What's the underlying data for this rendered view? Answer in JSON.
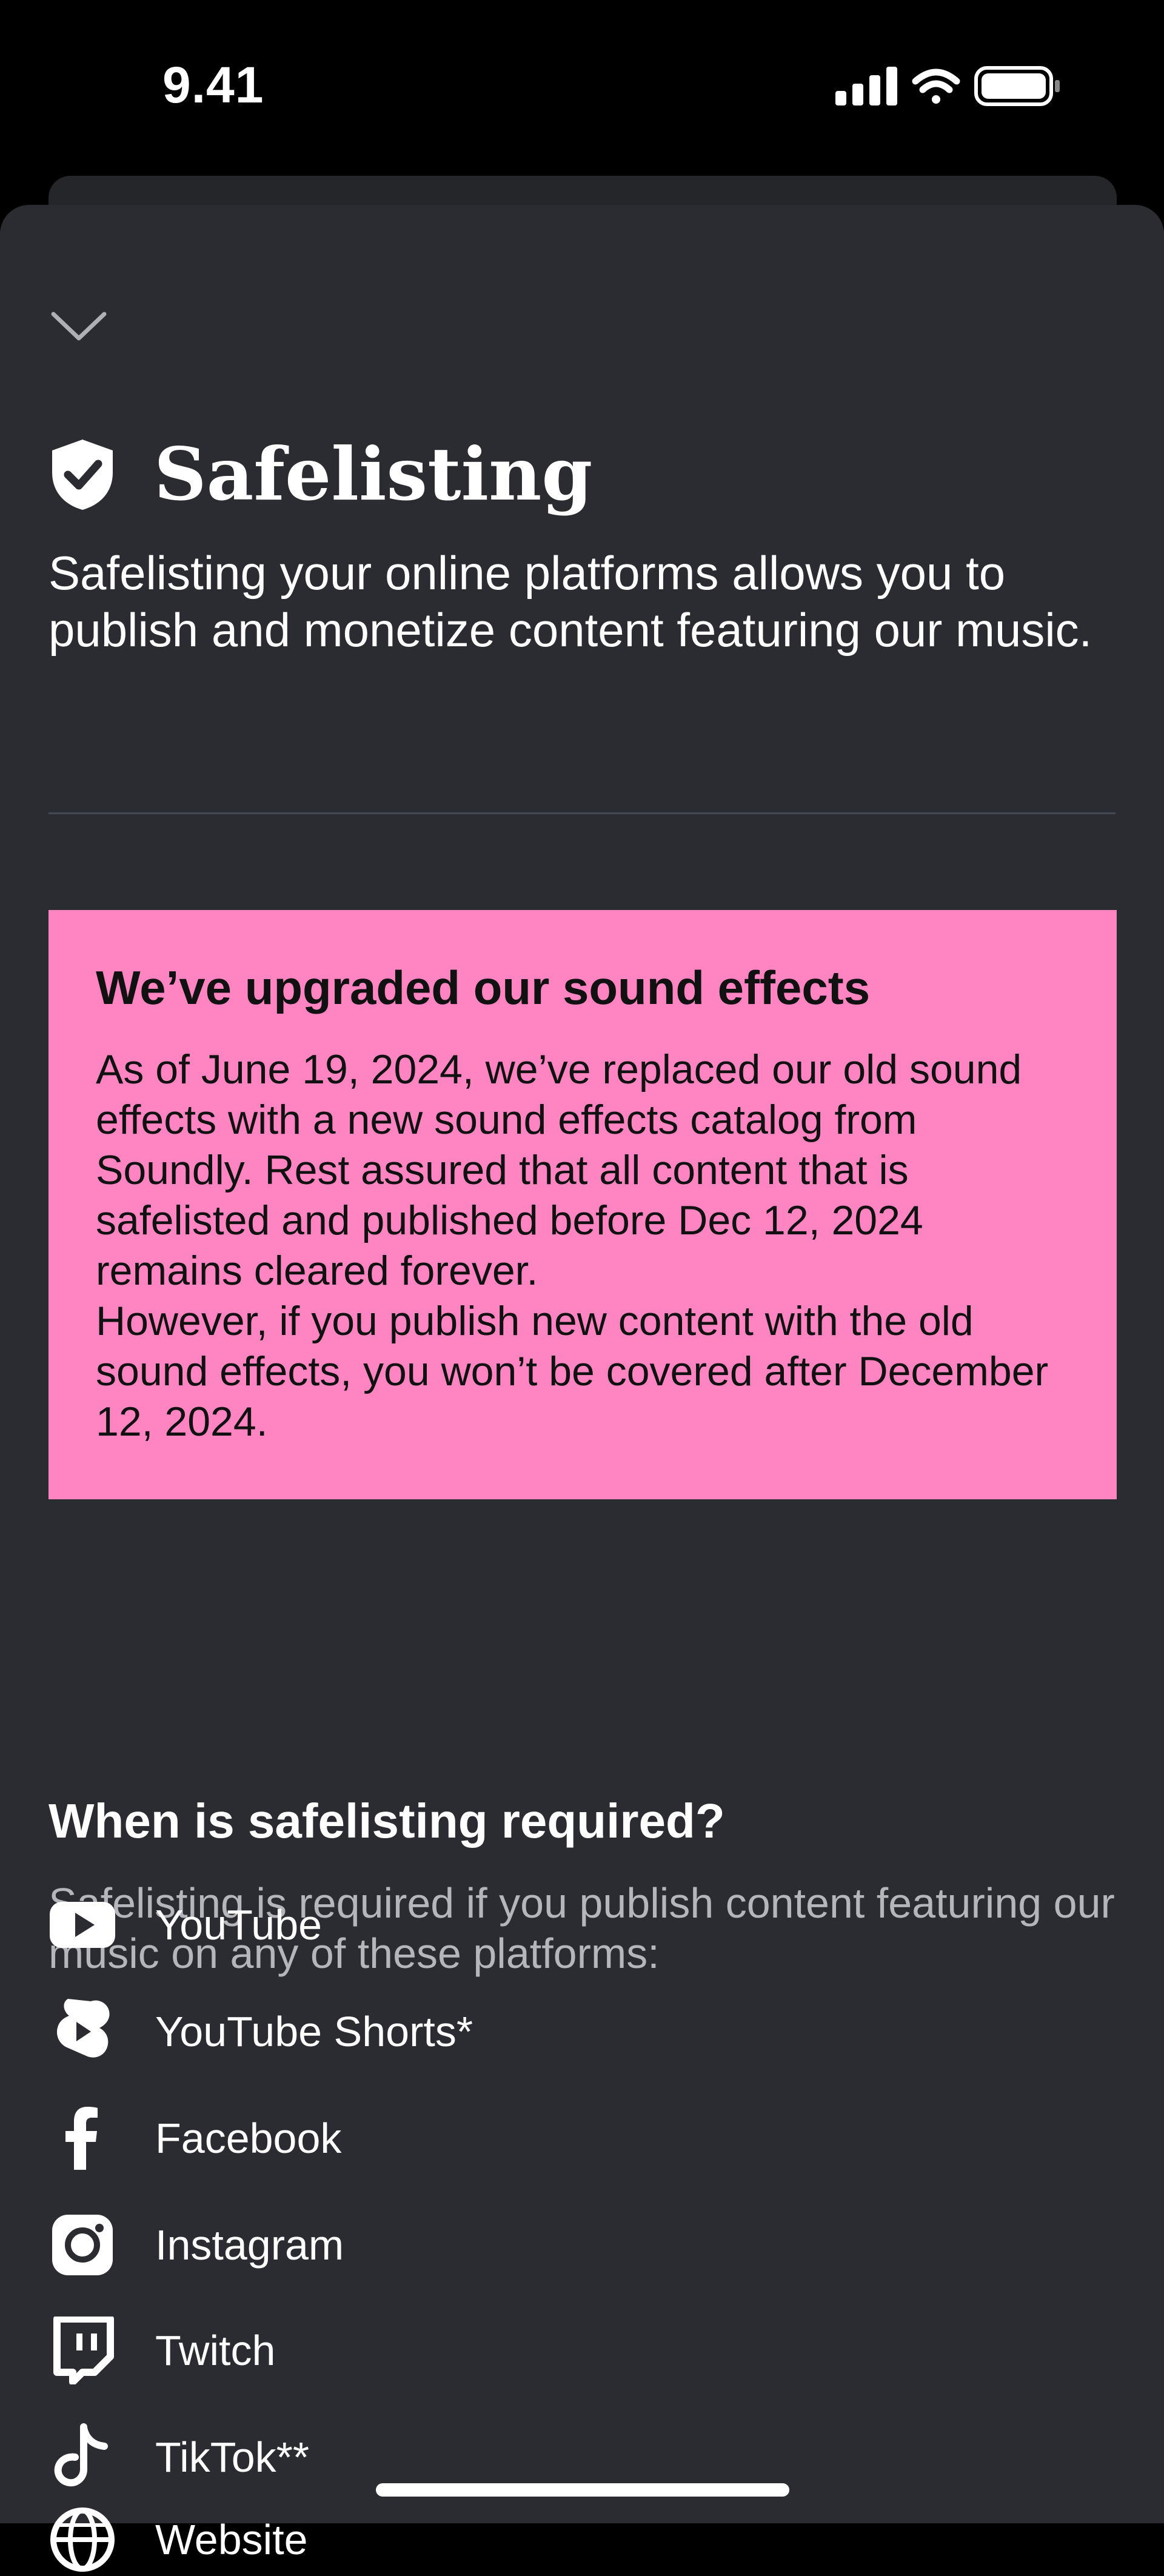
{
  "status_bar": {
    "time": "9.41"
  },
  "sheet": {
    "title": "Safelisting",
    "intro": "Safelisting your online platforms allows you to publish and monetize content featuring our music."
  },
  "notice": {
    "title": "We’ve upgraded our sound effects",
    "paragraph1": "As of June 19, 2024, we’ve replaced our old sound effects with a new sound effects catalog from Soundly. Rest assured that all content that is safelisted and published before Dec 12, 2024 remains cleared forever.",
    "paragraph2": "However, if you publish new content with the old sound effects, you won’t be covered after December 12, 2024.",
    "background_color": "#ff85c2"
  },
  "requirements": {
    "title": "When is safelisting required?",
    "description": "Safelisting is required if you publish content featuring our music on any of these platforms:"
  },
  "platforms": [
    {
      "icon": "youtube-icon",
      "label": "YouTube"
    },
    {
      "icon": "youtube-shorts-icon",
      "label": "YouTube Shorts*"
    },
    {
      "icon": "facebook-icon",
      "label": "Facebook"
    },
    {
      "icon": "instagram-icon",
      "label": "Instagram"
    },
    {
      "icon": "twitch-icon",
      "label": "Twitch"
    },
    {
      "icon": "tiktok-icon",
      "label": "TikTok**"
    },
    {
      "icon": "website-icon",
      "label": "Website"
    }
  ]
}
